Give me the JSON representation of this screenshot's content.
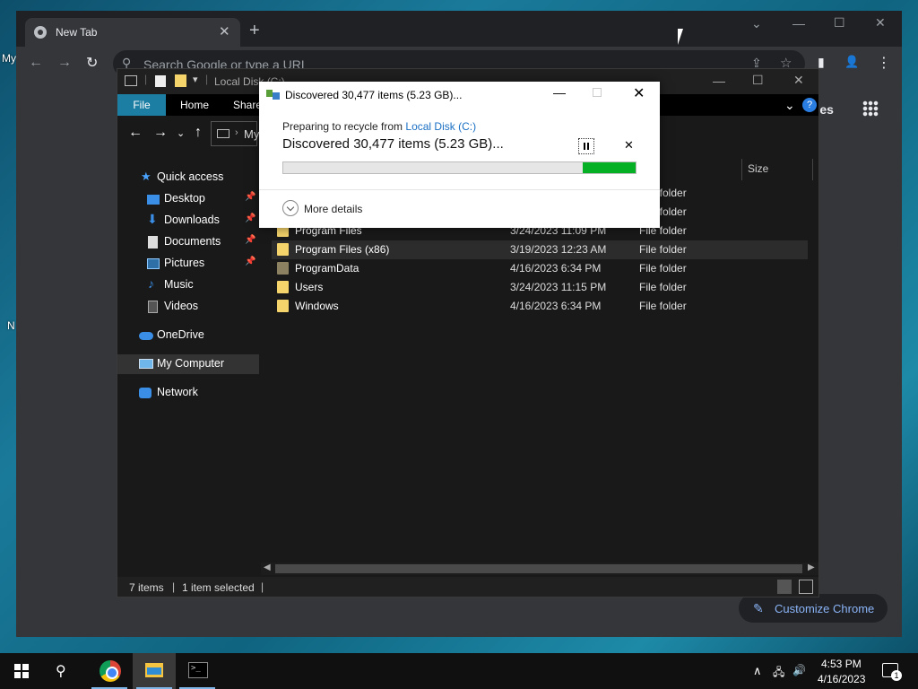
{
  "desktop": {
    "label_left_1": "My",
    "label_left_2": "N"
  },
  "chrome": {
    "tab_title": "New Tab",
    "tab_close": "✕",
    "new_tab": "+",
    "omnibox_placeholder": "Search Google or type a URL",
    "images_link": "ages",
    "customize_label": "Customize Chrome",
    "icons": {
      "back": "←",
      "forward": "→",
      "reload": "↻",
      "share": "⇪",
      "star": "☆",
      "menu": "⋮",
      "profile": "👤",
      "sidebar": "▮"
    },
    "window_controls": {
      "dropdown": "⌄",
      "minimize": "—",
      "maximize": "☐",
      "close": "✕"
    }
  },
  "explorer": {
    "title": "Local Disk (C:)",
    "window_controls": {
      "minimize": "—",
      "maximize": "☐",
      "close": "✕"
    },
    "ribbon": {
      "file": "File",
      "home": "Home",
      "share": "Share",
      "expand": "⌄",
      "help": "?"
    },
    "address_fragment": "My",
    "nav_items": [
      {
        "label": "Quick access"
      },
      {
        "label": "Desktop",
        "pinned": true
      },
      {
        "label": "Downloads",
        "pinned": true
      },
      {
        "label": "Documents",
        "pinned": true
      },
      {
        "label": "Pictures",
        "pinned": true
      },
      {
        "label": "Music"
      },
      {
        "label": "Videos"
      },
      {
        "label": "OneDrive"
      },
      {
        "label": "My Computer"
      },
      {
        "label": "Network"
      }
    ],
    "column_size": "Size",
    "rows": [
      {
        "name": "",
        "date": "",
        "type": "File folder"
      },
      {
        "name": "",
        "date": "",
        "type": "File folder"
      },
      {
        "name": "Program Files",
        "date": "3/24/2023 11:09 PM",
        "type": "File folder"
      },
      {
        "name": "Program Files (x86)",
        "date": "3/19/2023 12:23 AM",
        "type": "File folder"
      },
      {
        "name": "ProgramData",
        "date": "4/16/2023 6:34 PM",
        "type": "File folder"
      },
      {
        "name": "Users",
        "date": "3/24/2023 11:15 PM",
        "type": "File folder"
      },
      {
        "name": "Windows",
        "date": "4/16/2023 6:34 PM",
        "type": "File folder"
      }
    ],
    "status_items": "7 items",
    "status_selected": "1 item selected",
    "status_sep": "|"
  },
  "dialog": {
    "title": "Discovered 30,477 items (5.23 GB)...",
    "prep_prefix": "Preparing to recycle from ",
    "prep_link": "Local Disk (C:)",
    "main": "Discovered 30,477 items (5.23 GB)...",
    "cancel": "✕",
    "minimize": "—",
    "close": "✕",
    "progress": {
      "indeterminate_start": 0.85,
      "indeterminate_end": 1.0
    },
    "more_details": "More details"
  },
  "taskbar": {
    "time": "4:53 PM",
    "date": "4/16/2023",
    "notification_count": "1",
    "tray": {
      "chevron": "∧",
      "network": "🖧",
      "volume": "🔊"
    },
    "search_icon": "⚲"
  }
}
